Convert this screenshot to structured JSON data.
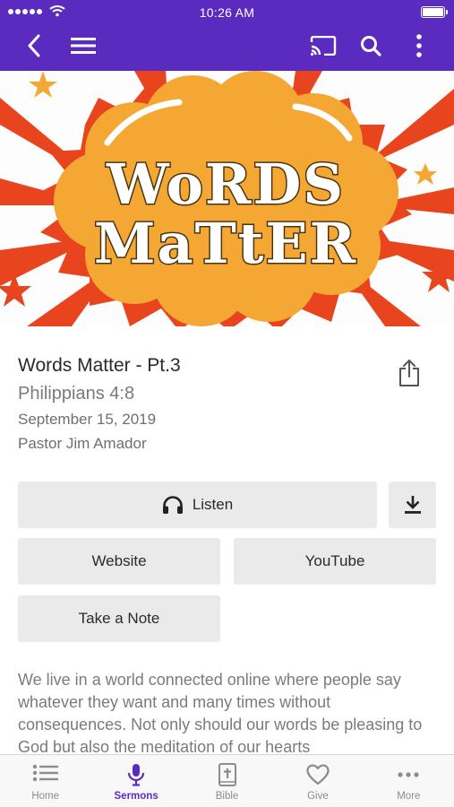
{
  "status_bar": {
    "time": "10:26 AM"
  },
  "app_bar": {
    "back_icon": "chevron-left-icon",
    "menu_icon": "hamburger-menu-icon",
    "cast_icon": "cast-icon",
    "search_icon": "search-icon",
    "more_icon": "more-vertical-icon",
    "background_color": "#5b2bbf"
  },
  "hero": {
    "artwork_line1": "WoRDS",
    "artwork_line2": "MaTtER"
  },
  "sermon": {
    "title": "Words Matter - Pt.3",
    "scripture": "Philippians 4:8",
    "date": "September 15, 2019",
    "speaker": "Pastor Jim Amador"
  },
  "actions": {
    "listen": "Listen",
    "website": "Website",
    "youtube": "YouTube",
    "take_note": "Take a Note"
  },
  "description": "We live in a world connected online where people say whatever they want and many times without consequences. Not only should our words be pleasing to God but also the meditation of our hearts",
  "tabs": [
    {
      "label": "Home",
      "icon": "list-icon",
      "active": false
    },
    {
      "label": "Sermons",
      "icon": "microphone-icon",
      "active": true
    },
    {
      "label": "Bible",
      "icon": "bible-icon",
      "active": false
    },
    {
      "label": "Give",
      "icon": "heart-icon",
      "active": false
    },
    {
      "label": "More",
      "icon": "more-horizontal-icon",
      "active": false
    }
  ],
  "colors": {
    "accent": "#5b2bbf",
    "burst_orange": "#f4a833",
    "burst_red": "#e8451f",
    "button_bg": "#eaeaeb"
  }
}
